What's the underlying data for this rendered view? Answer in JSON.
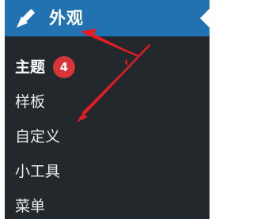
{
  "menu": {
    "title": "外观",
    "icon": "paintbrush-icon",
    "colors": {
      "panel": "#23282d",
      "header": "#2271b1",
      "badge": "#d63638",
      "arrow": "#e51c23"
    }
  },
  "submenu": {
    "items": [
      {
        "label": "主题",
        "badge": "4",
        "current": true
      },
      {
        "label": "样板"
      },
      {
        "label": "自定义"
      },
      {
        "label": "小工具"
      },
      {
        "label": "菜单"
      }
    ]
  }
}
